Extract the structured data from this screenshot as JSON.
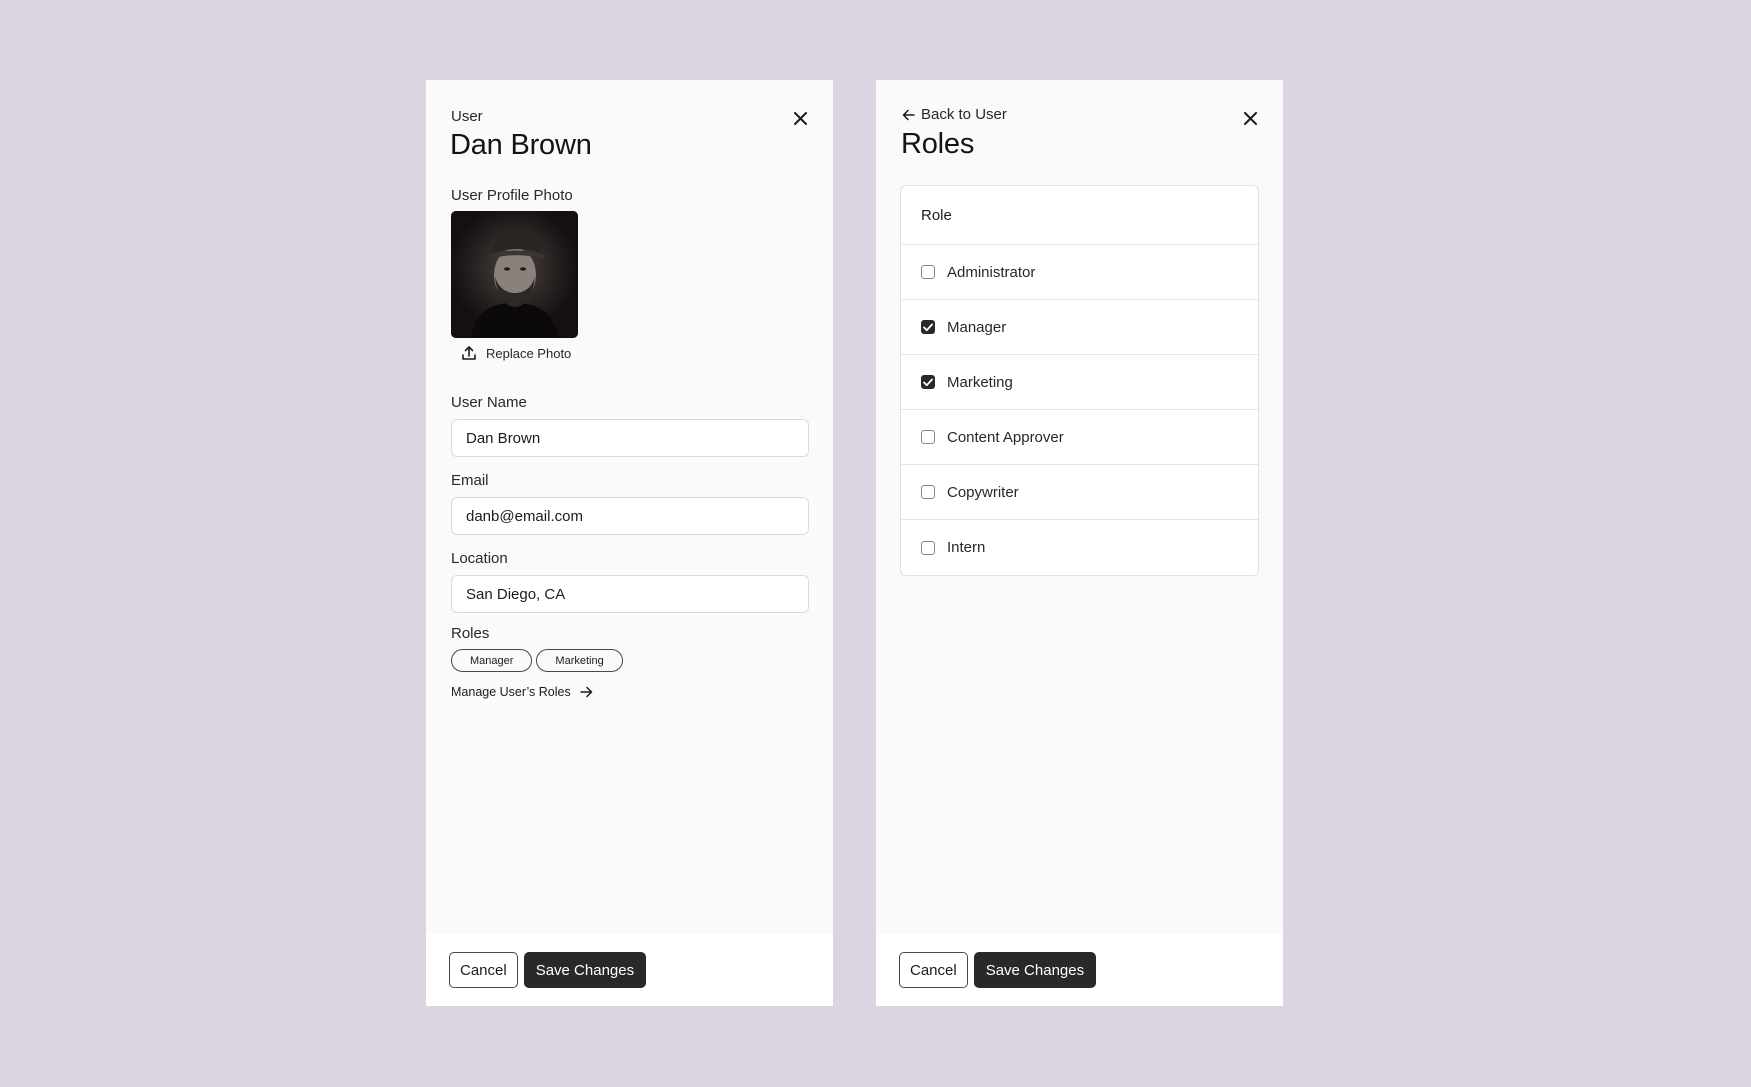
{
  "user_panel": {
    "eyebrow": "User",
    "title": "Dan Brown",
    "photo_label": "User Profile Photo",
    "replace_photo": "Replace Photo",
    "user_name_label": "User Name",
    "user_name_value": "Dan Brown",
    "email_label": "Email",
    "email_value": "danb@email.com",
    "location_label": "Location",
    "location_value": "San Diego, CA",
    "roles_label": "Roles",
    "role_chips": [
      "Manager",
      "Marketing"
    ],
    "manage_roles": "Manage User’s Roles",
    "cancel": "Cancel",
    "save": "Save Changes"
  },
  "roles_panel": {
    "back": "Back to User",
    "title": "Roles",
    "column_header": "Role",
    "roles": [
      {
        "label": "Administrator",
        "checked": false
      },
      {
        "label": "Manager",
        "checked": true
      },
      {
        "label": "Marketing",
        "checked": true
      },
      {
        "label": "Content Approver",
        "checked": false
      },
      {
        "label": "Copywriter",
        "checked": false
      },
      {
        "label": "Intern",
        "checked": false
      }
    ],
    "cancel": "Cancel",
    "save": "Save Changes"
  },
  "icons": {
    "close": "close-icon",
    "upload": "upload-icon",
    "arrow_right": "arrow-right-icon",
    "arrow_left": "arrow-left-icon",
    "checkmark": "checkmark-icon"
  },
  "colors": {
    "background": "#dad5e1",
    "panel": "#fafafa",
    "primary_button": "#2b2829"
  }
}
